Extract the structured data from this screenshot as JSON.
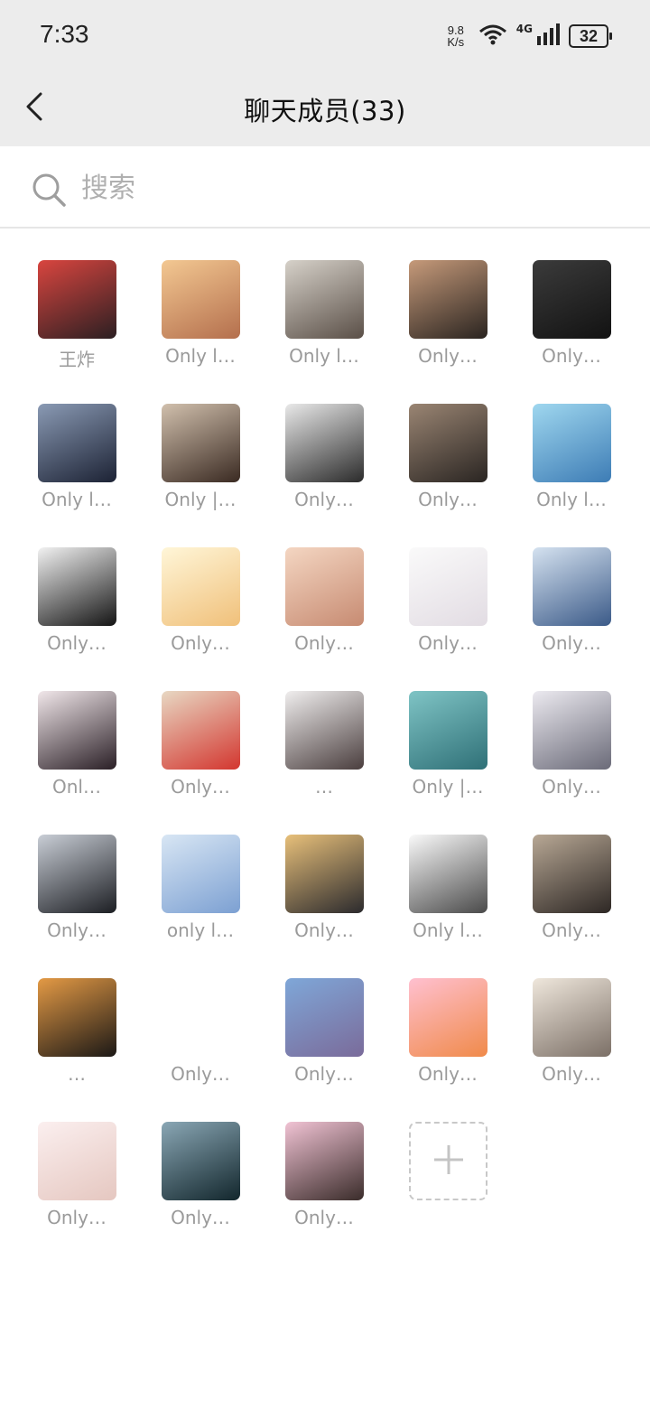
{
  "status": {
    "time": "7:33",
    "net_speed_top": "9.8",
    "net_speed_bottom": "K/s",
    "network": "4G",
    "battery": "32"
  },
  "nav": {
    "title": "聊天成员(33)"
  },
  "search": {
    "placeholder": "搜索"
  },
  "members": [
    {
      "name": "王炸",
      "c1": "#d9453f",
      "c2": "#2b1f22"
    },
    {
      "name": "Only l…",
      "c1": "#f3c892",
      "c2": "#b46f4d"
    },
    {
      "name": "Only l…",
      "c1": "#d6d1c9",
      "c2": "#5a4f47"
    },
    {
      "name": "Only…",
      "c1": "#c69a7a",
      "c2": "#2a2420"
    },
    {
      "name": "Only…",
      "c1": "#3b3b3b",
      "c2": "#121212"
    },
    {
      "name": "Only l…",
      "c1": "#8a9ab4",
      "c2": "#1c2234"
    },
    {
      "name": "Only |…",
      "c1": "#d1c0ad",
      "c2": "#3a2a22"
    },
    {
      "name": "Only…",
      "c1": "#e9e9e9",
      "c2": "#2b2b2b"
    },
    {
      "name": "Only…",
      "c1": "#9a8573",
      "c2": "#2a2522"
    },
    {
      "name": "Only l…",
      "c1": "#9fd7ef",
      "c2": "#3d7cb5"
    },
    {
      "name": "Only…",
      "c1": "#f2f2f2",
      "c2": "#141414"
    },
    {
      "name": "Only…",
      "c1": "#fff6d8",
      "c2": "#f0c07a"
    },
    {
      "name": "Only…",
      "c1": "#f4d6c2",
      "c2": "#c78b72"
    },
    {
      "name": "Only…",
      "c1": "#fafafa",
      "c2": "#e2dce3"
    },
    {
      "name": "Only…",
      "c1": "#d5e2f0",
      "c2": "#3b5a88"
    },
    {
      "name": "Onl…",
      "c1": "#f1e7ea",
      "c2": "#2a1f26"
    },
    {
      "name": "Only…",
      "c1": "#e8d8c3",
      "c2": "#d3362f"
    },
    {
      "name": "…",
      "c1": "#f0eeee",
      "c2": "#4a3e3e"
    },
    {
      "name": "Only |…",
      "c1": "#7fc4c5",
      "c2": "#2f7077"
    },
    {
      "name": "Only…",
      "c1": "#eceaf0",
      "c2": "#6a6a78"
    },
    {
      "name": "Only…",
      "c1": "#c9ced6",
      "c2": "#1c1e23"
    },
    {
      "name": "only l…",
      "c1": "#d8e6f4",
      "c2": "#7ca0d2"
    },
    {
      "name": "Only…",
      "c1": "#e8c07a",
      "c2": "#2b2a2d"
    },
    {
      "name": "Only l…",
      "c1": "#fafafa",
      "c2": "#4a4a4a"
    },
    {
      "name": "Only…",
      "c1": "#b8a895",
      "c2": "#2d2724"
    },
    {
      "name": "…",
      "c1": "#e49a45",
      "c2": "#1b1816"
    },
    {
      "name": "Only…",
      "c1": "#ffffff",
      "c2": "#ffffff"
    },
    {
      "name": "Only…",
      "c1": "#7fa7d8",
      "c2": "#7a6b9a"
    },
    {
      "name": "Only…",
      "c1": "#ffc0d0",
      "c2": "#f08a4a"
    },
    {
      "name": "Only…",
      "c1": "#efe7dc",
      "c2": "#7b6f66"
    },
    {
      "name": "Only…",
      "c1": "#fbefef",
      "c2": "#e5c7c0"
    },
    {
      "name": "Only…",
      "c1": "#8aa7b5",
      "c2": "#12262c"
    },
    {
      "name": "Only…",
      "c1": "#f1c3d4",
      "c2": "#3a2c2a"
    }
  ],
  "add_member": {
    "icon": "plus-icon"
  }
}
